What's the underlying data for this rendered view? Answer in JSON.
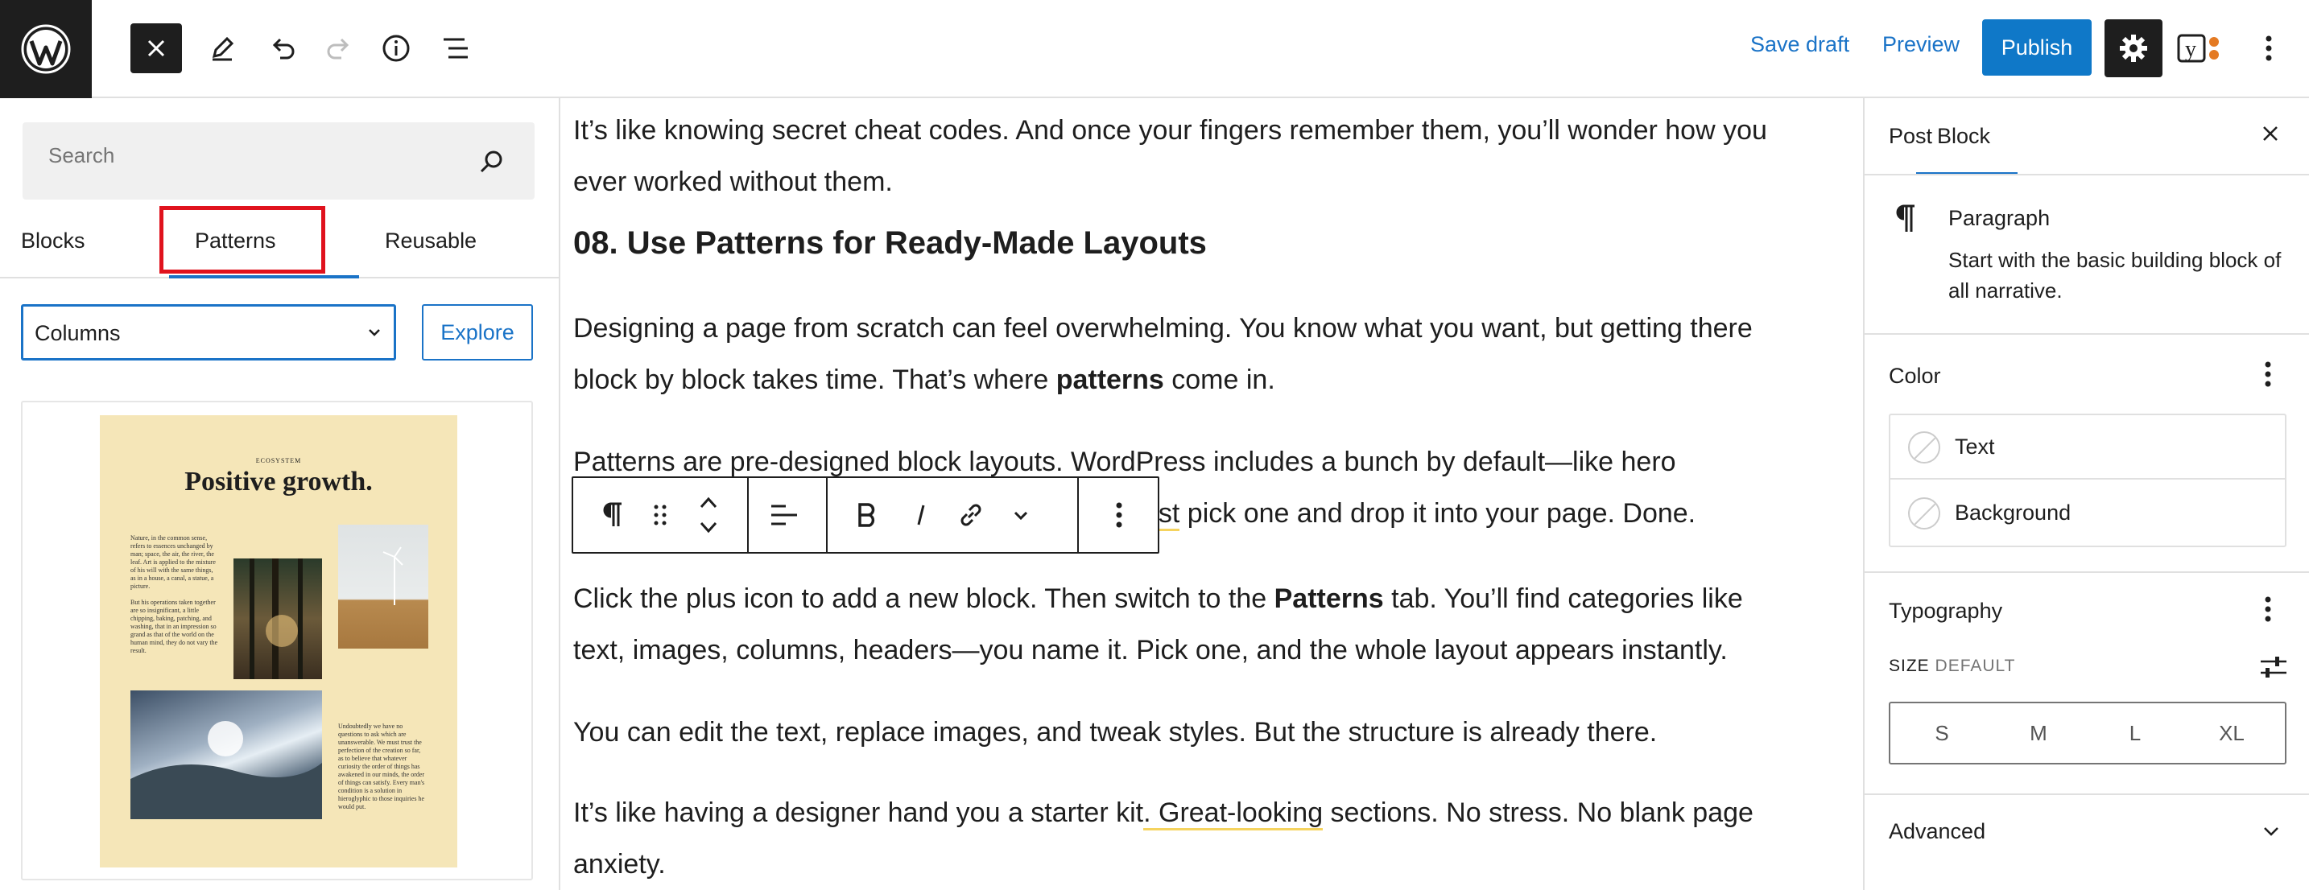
{
  "topbar": {
    "save_draft": "Save draft",
    "preview": "Preview",
    "publish": "Publish",
    "icons": [
      "wordpress-logo",
      "close-icon",
      "pen-icon",
      "undo-icon",
      "redo-icon",
      "info-icon",
      "list-view-icon",
      "gear-icon",
      "yoast-icon",
      "more-vertical-icon"
    ]
  },
  "inserter": {
    "search_placeholder": "Search",
    "tabs": [
      "Blocks",
      "Patterns",
      "Reusable"
    ],
    "active_tab": "Patterns",
    "category": "Columns",
    "explore": "Explore",
    "pattern_preview": {
      "eyebrow": "ECOSYSTEM",
      "title": "Positive growth.",
      "text1": "Nature, in the common sense, refers to essences unchanged by man; space, the air, the river, the leaf. Art is applied to the mixture of his will with the same things, as in a house, a canal, a statue, a picture.",
      "text2": "But his operations taken together are so insignificant, a little chipping, baking, patching, and washing, that in an impression so grand as that of the world on the human mind, they do not vary the result.",
      "text3": "Undoubtedly we have no questions to ask which are unanswerable. We must trust the perfection of the creation so far, as to believe that whatever curiosity the order of things has awakened in our minds, the order of things can satisfy. Every man's condition is a solution in hieroglyphic to those inquiries he would put."
    }
  },
  "editor": {
    "p_top_1": "It’s like knowing secret cheat codes. And once your fingers remember them, you’ll wonder how you",
    "p_top_2": "ever worked without them.",
    "heading": "08. Use Patterns for Ready-Made Layouts",
    "p1_line1": "Designing a page from scratch can feel overwhelming. You know what you want, but getting there",
    "p1_line2a": "block by block takes time. That’s where ",
    "p1_line2b": "patterns",
    "p1_line2c": " come in.",
    "p2_line1": "Patterns are pre-designed block layouts. WordPress includes a bunch by default—like hero",
    "p2_line2a": "ust",
    "p2_line2b": " pick one and drop it into your page. Done.",
    "p3_line1a": "Click the plus icon to add a new block. Then switch to the ",
    "p3_line1b": "Patterns",
    "p3_line1c": " tab. You’ll find categories like",
    "p3_line2": "text, images, columns, headers—you name it. Pick one, and the whole layout appears instantly.",
    "p4": "You can edit the text, replace images, and tweak styles. But the structure is already there.",
    "p5_line1a": "It’s like having a designer hand you a starter kit",
    "p5_line1b": ". Great-looking",
    "p5_line1c": " sections. No stress. No blank page",
    "p5_line2": "anxiety.",
    "toolbar_icons": [
      "paragraph-icon",
      "drag-handle-icon",
      "move-up-down-icon",
      "align-left-icon",
      "bold-icon",
      "italic-icon",
      "link-icon",
      "chevron-down-icon",
      "more-vertical-icon"
    ]
  },
  "settings": {
    "tabs": [
      "Post",
      "Block"
    ],
    "active_tab": "Block",
    "block_name": "Paragraph",
    "block_description": "Start with the basic building block of all narrative.",
    "color_title": "Color",
    "color_items": [
      "Text",
      "Background"
    ],
    "typography_title": "Typography",
    "size_label": "SIZE",
    "size_default": "DEFAULT",
    "size_options": [
      "S",
      "M",
      "L",
      "XL"
    ],
    "advanced_title": "Advanced"
  },
  "colors": {
    "accent": "#1a73c7",
    "publish": "#0f78c8",
    "highlight": "#e0121d",
    "dark": "#1e1e1e",
    "link_underline": "#f5d35e"
  }
}
